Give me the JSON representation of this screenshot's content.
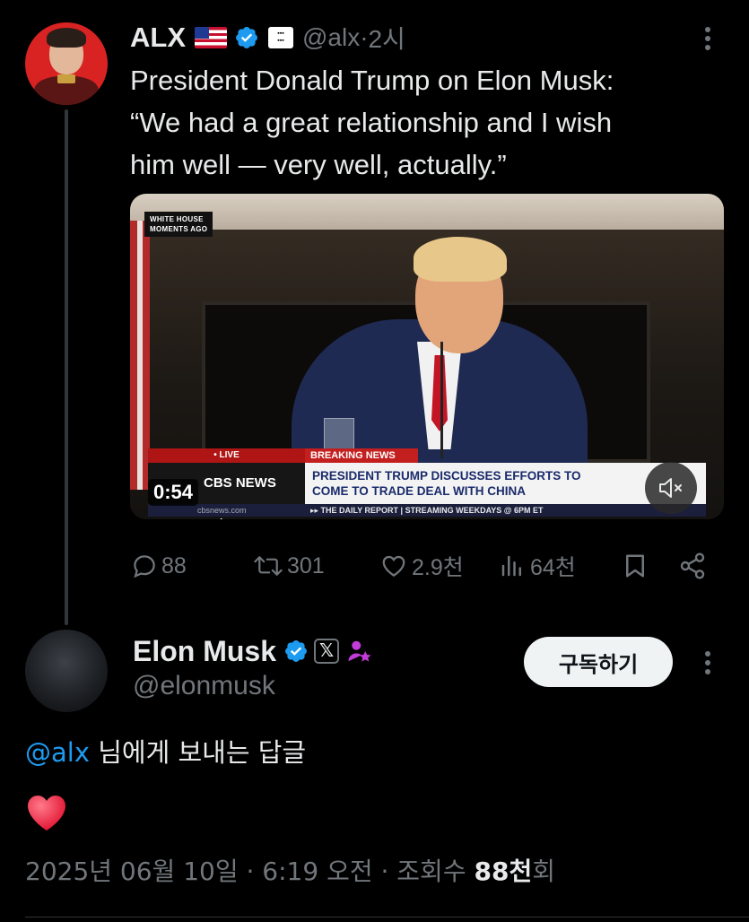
{
  "tweet": {
    "author_name": "ALX",
    "author_handle": "@alx",
    "time_sep": " · ",
    "time": "2시",
    "text": "President Donald Trump on Elon Musk:\n“We had a great relationship and I wish\nhim well — very well, actually.”",
    "media": {
      "corner_tag": "WHITE HOUSE\nMOMENTS AGO",
      "live_label": "• LIVE",
      "breaking_label": "BREAKING NEWS",
      "network": "CBS NEWS 24/7",
      "headline": "PRESIDENT TRUMP DISCUSSES EFFORTS TO\nCOME TO TRADE DEAL WITH CHINA",
      "site": "cbsnews.com",
      "ticker": "▸▸ THE DAILY REPORT | STREAMING WEEKDAYS @ 6PM ET",
      "duration": "0:54"
    },
    "stats": {
      "replies": "88",
      "reposts": "301",
      "likes": "2.9천",
      "views": "64천"
    }
  },
  "reply": {
    "author_name": "Elon Musk",
    "author_handle": "@elonmusk",
    "subscribe_label": "구독하기",
    "mention": "@alx",
    "reply_to_suffix": " 님에게 보내는 답글",
    "body_emoji": "heart",
    "timestamp_prefix": "2025년 06월 10일 · 6:19 오전 · 조회수 ",
    "timestamp_views": "88천",
    "timestamp_suffix": "회"
  },
  "colors": {
    "background": "#000000",
    "text": "#e7e9ea",
    "muted": "#71767b",
    "accent": "#1d9bf0",
    "heart": "#f91880"
  }
}
